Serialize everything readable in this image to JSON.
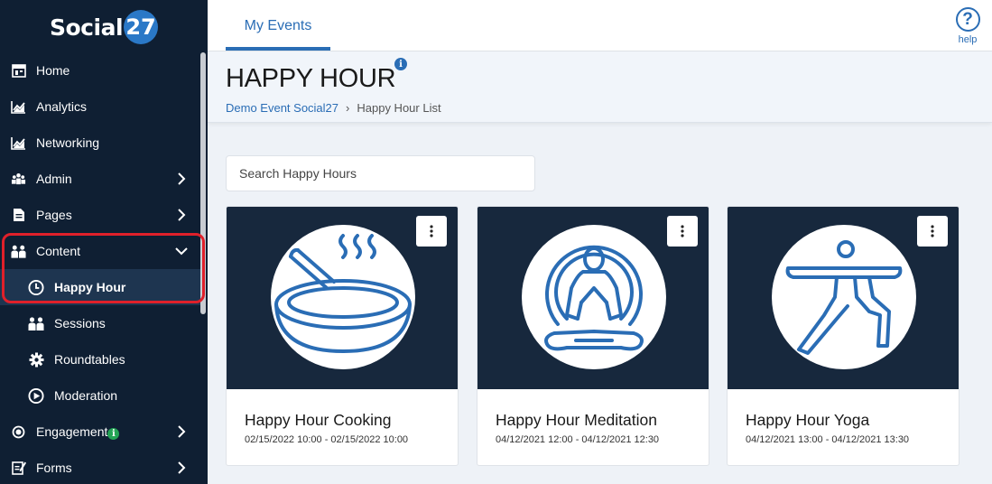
{
  "app": {
    "logo_text": "Social",
    "logo_number": "27"
  },
  "sidebar": {
    "items": [
      {
        "label": "Home",
        "icon": "home-icon"
      },
      {
        "label": "Analytics",
        "icon": "analytics-icon"
      },
      {
        "label": "Networking",
        "icon": "networking-icon"
      },
      {
        "label": "Admin",
        "icon": "admin-icon"
      },
      {
        "label": "Pages",
        "icon": "pages-icon"
      },
      {
        "label": "Content",
        "icon": "content-icon"
      },
      {
        "label": "Happy Hour",
        "icon": "clock-icon"
      },
      {
        "label": "Sessions",
        "icon": "sessions-icon"
      },
      {
        "label": "Roundtables",
        "icon": "gear-icon"
      },
      {
        "label": "Moderation",
        "icon": "moderation-icon"
      },
      {
        "label": "Engagement",
        "icon": "engagement-icon",
        "badge": "i"
      },
      {
        "label": "Forms",
        "icon": "forms-icon"
      }
    ]
  },
  "topbar": {
    "tab_label": "My Events",
    "help_label": "help",
    "help_symbol": "?"
  },
  "header": {
    "title": "HAPPY HOUR",
    "info_symbol": "i",
    "breadcrumb": {
      "parent": "Demo Event Social27",
      "separator": "›",
      "current": "Happy Hour List"
    }
  },
  "search": {
    "placeholder": "Search Happy Hours"
  },
  "cards": [
    {
      "title": "Happy Hour Cooking",
      "date": "02/15/2022 10:00 - 02/15/2022 10:00",
      "icon": "cooking-pan-icon"
    },
    {
      "title": "Happy Hour Meditation",
      "date": "04/12/2021 12:00 - 04/12/2021 12:30",
      "icon": "meditation-icon"
    },
    {
      "title": "Happy Hour Yoga",
      "date": "04/12/2021 13:00 - 04/12/2021 13:30",
      "icon": "yoga-icon"
    }
  ],
  "colors": {
    "sidebar_bg": "#0f1f33",
    "accent": "#2a6db5",
    "highlight": "#e0202a",
    "badge_green": "#23a455"
  }
}
